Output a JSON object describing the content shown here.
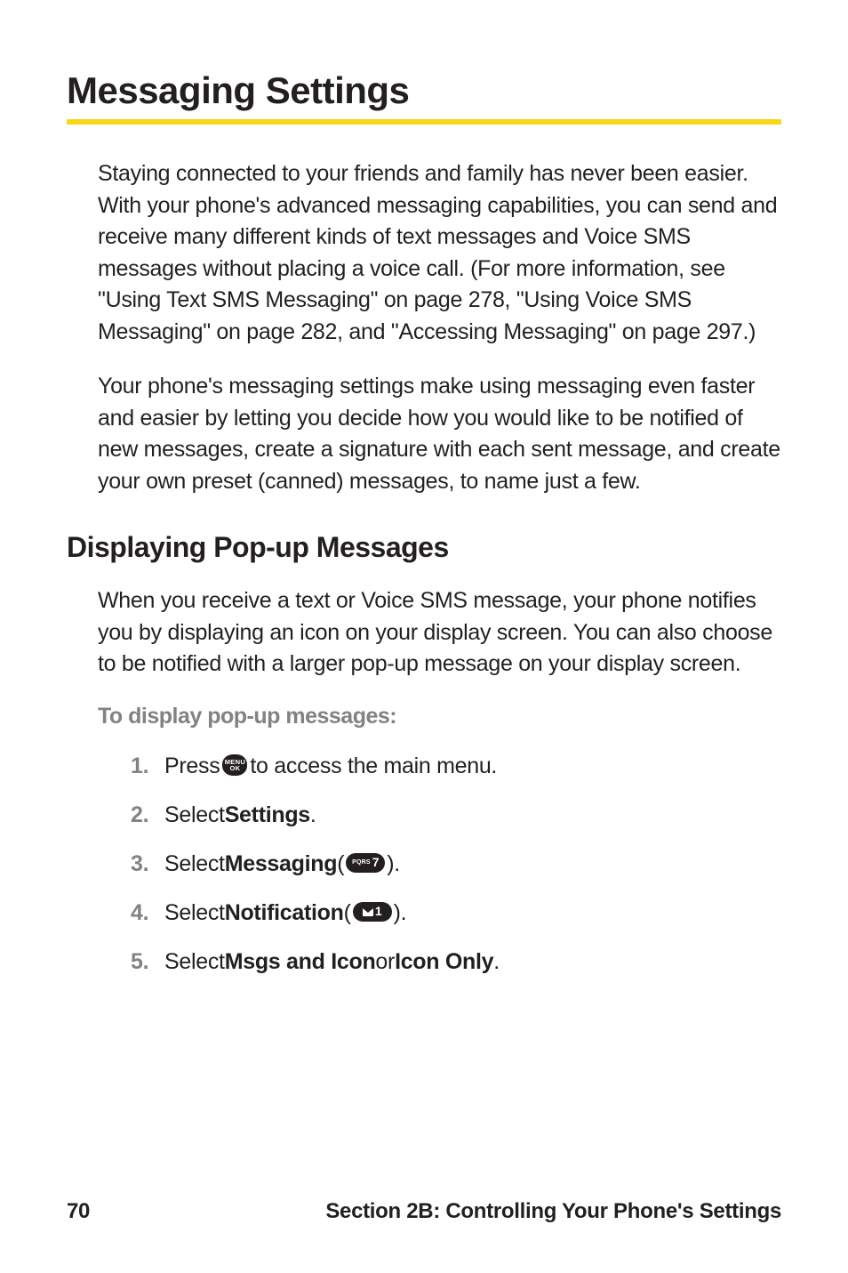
{
  "heading": "Messaging Settings",
  "paragraph1": "Staying connected to your friends and family has never been easier. With your phone's advanced messaging capabilities, you can send and receive many different kinds of text messages and Voice SMS messages without placing a voice call. (For more information, see \"Using Text SMS Messaging\" on page 278, \"Using Voice SMS Messaging\" on page 282, and \"Accessing Messaging\" on page 297.)",
  "paragraph2": "Your phone's messaging settings make using messaging even faster and easier by letting you decide how you would like to be notified of new messages, create a signature with each sent message, and create your own preset (canned) messages, to name just a few.",
  "subheading": "Displaying Pop-up Messages",
  "paragraph3": "When you receive a text or Voice SMS message, your phone notifies you by displaying an icon on your display screen. You can also choose to be notified with a larger pop-up message on your display screen.",
  "instruction_label": "To display pop-up messages:",
  "steps": {
    "num1": "1.",
    "num2": "2.",
    "num3": "3.",
    "num4": "4.",
    "num5": "5.",
    "step1_prefix": "Press ",
    "step1_suffix": " to access the main menu.",
    "step2_prefix": "Select ",
    "step2_bold": "Settings",
    "step2_suffix": ".",
    "step3_prefix": "Select ",
    "step3_bold": "Messaging",
    "step3_paren_open": " (",
    "step3_paren_close": ").",
    "step4_prefix": "Select ",
    "step4_bold": "Notification",
    "step4_paren_open": " (",
    "step4_paren_close": ").",
    "step5_prefix": "Select ",
    "step5_bold1": "Msgs and Icon",
    "step5_or": " or ",
    "step5_bold2": "Icon Only",
    "step5_suffix": "."
  },
  "icons": {
    "menu_top": "MENU",
    "menu_bottom": "OK",
    "key7_left": "PQRS",
    "key7_right": "7",
    "key1_right": "1"
  },
  "footer": {
    "page_number": "70",
    "section_label": "Section 2B: Controlling Your Phone's Settings"
  }
}
